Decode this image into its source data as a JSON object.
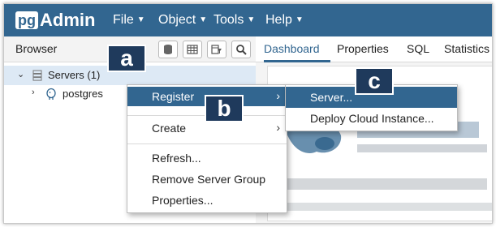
{
  "app": {
    "logo_pg": "pg",
    "logo_admin": "Admin"
  },
  "menubar": [
    {
      "label": "File"
    },
    {
      "label": "Object"
    },
    {
      "label": "Tools"
    },
    {
      "label": "Help"
    }
  ],
  "browser": {
    "title": "Browser"
  },
  "tabs": [
    {
      "label": "Dashboard",
      "active": true
    },
    {
      "label": "Properties"
    },
    {
      "label": "SQL"
    },
    {
      "label": "Statistics"
    }
  ],
  "tree": {
    "servers_label": "Servers (1)",
    "child_label": "postgres"
  },
  "context_menu": {
    "register": "Register",
    "create": "Create",
    "refresh": "Refresh...",
    "remove_group": "Remove Server Group",
    "properties": "Properties..."
  },
  "submenu": {
    "server": "Server...",
    "deploy_cloud": "Deploy Cloud Instance..."
  },
  "callouts": {
    "a": "a",
    "b": "b",
    "c": "c"
  },
  "colors": {
    "brand": "#326690",
    "callout": "#1f3a5c",
    "selection": "#dde9f5"
  }
}
